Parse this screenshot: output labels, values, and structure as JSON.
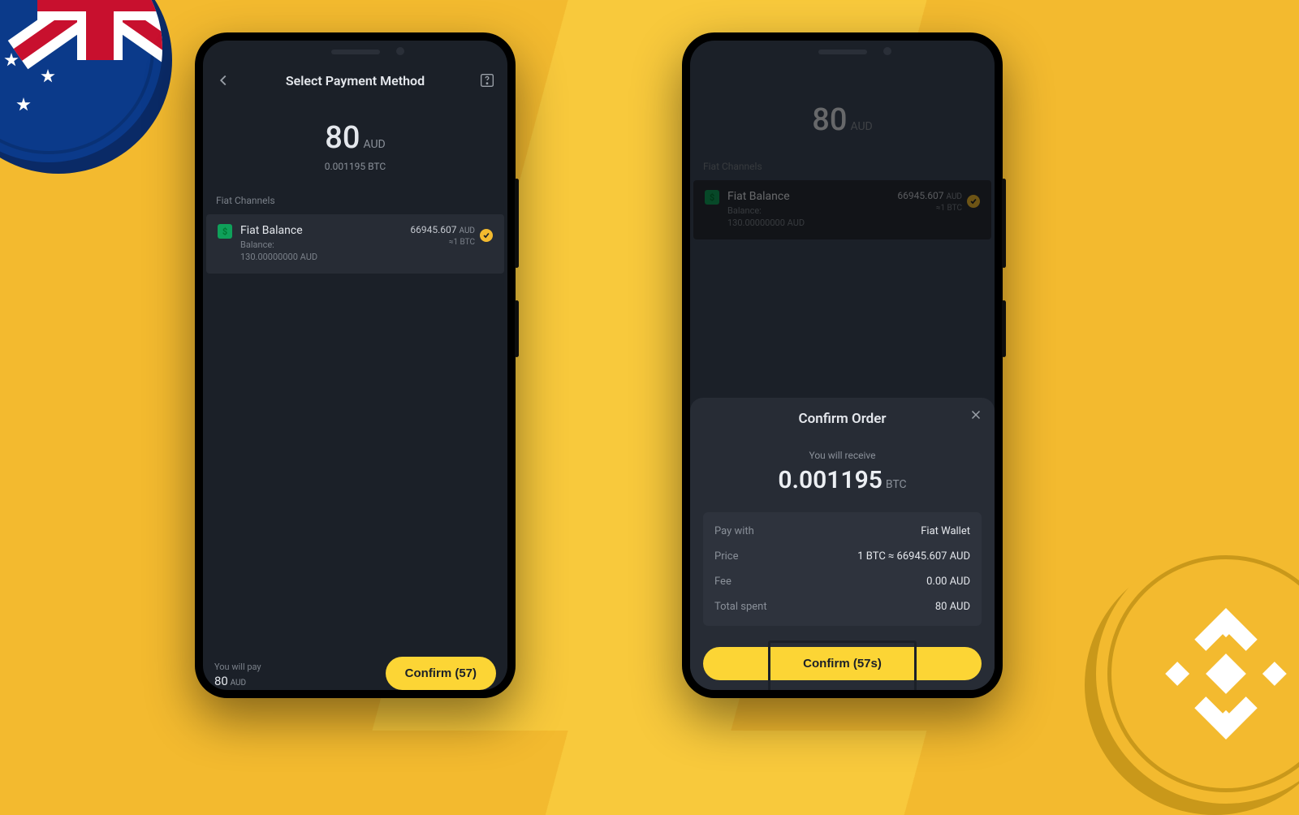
{
  "left": {
    "title": "Select Payment Method",
    "amount": "80",
    "currency": "AUD",
    "amount_sub": "0.001195 BTC",
    "section": "Fiat Channels",
    "channel": {
      "name": "Fiat Balance",
      "sub1": "Balance:",
      "sub2": "130.00000000 AUD",
      "rate": "66945.607",
      "rate_cur": "AUD",
      "per": "≈1 BTC"
    },
    "footer_label": "You will pay",
    "footer_amount": "80",
    "footer_cur": "AUD",
    "confirm": "Confirm (57)"
  },
  "right": {
    "amount": "80",
    "currency": "AUD",
    "section": "Fiat Channels",
    "channel": {
      "name": "Fiat Balance",
      "sub1": "Balance:",
      "sub2": "130.00000000 AUD",
      "rate": "66945.607",
      "rate_cur": "AUD",
      "per": "≈1 BTC"
    },
    "modal": {
      "title": "Confirm Order",
      "receive_label": "You will receive",
      "receive_amount": "0.001195",
      "receive_unit": "BTC",
      "rows": {
        "pay_with_k": "Pay with",
        "pay_with_v": "Fiat Wallet",
        "price_k": "Price",
        "price_v": "1 BTC ≈ 66945.607 AUD",
        "fee_k": "Fee",
        "fee_v": "0.00 AUD",
        "total_k": "Total spent",
        "total_v": "80 AUD"
      },
      "confirm": "Confirm (57s)"
    }
  }
}
